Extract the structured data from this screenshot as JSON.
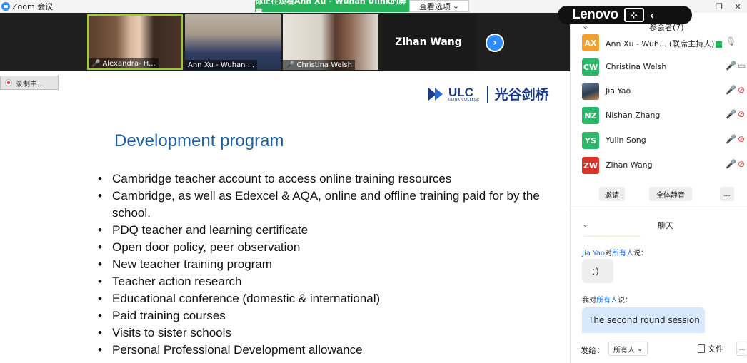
{
  "window": {
    "title": "Zoom 会议"
  },
  "share_banner": {
    "text": "你正在观看Ann Xu - Wuhan Ulink的屏幕",
    "view_options": "查看选项"
  },
  "videos": {
    "tiles": [
      {
        "name": "Alexandra- H..."
      },
      {
        "name": "Ann Xu - Wuhan ..."
      },
      {
        "name": "Christina Welsh"
      }
    ],
    "name_only": "Zihan Wang"
  },
  "recording": {
    "label": "录制中..."
  },
  "lenovo": {
    "word": "Lenovo"
  },
  "slide": {
    "logo_brand": "ULC",
    "logo_sub": "ULINK COLLEGE",
    "logo_cn": "光谷剑桥",
    "title": "Development program",
    "bullets": [
      "Cambridge teacher account to access online training resources",
      "Cambridge, as well as Edexcel & AQA, online and offline training paid for by the school.",
      "PDQ teacher and learning certificate",
      "Open door policy, peer observation",
      "New teacher training program",
      "Teacher action research",
      "Educational conference (domestic & international)",
      "Paid training courses",
      "Visits to sister schools",
      "Personal Professional Development allowance"
    ]
  },
  "participants": {
    "header": "参会者(7)",
    "rows": [
      {
        "initials": "AX",
        "name": "Ann Xu - Wuh... (联席主持人)",
        "color": "#f0a030"
      },
      {
        "initials": "CW",
        "name": "Christina Welsh",
        "color": "#2db76a"
      },
      {
        "initials": "",
        "name": "Jia Yao",
        "color": "#34495e"
      },
      {
        "initials": "NZ",
        "name": "Nishan Zhang",
        "color": "#2db76a"
      },
      {
        "initials": "YS",
        "name": "Yulin Song",
        "color": "#2db76a"
      },
      {
        "initials": "ZW",
        "name": "Zihan Wang",
        "color": "#d9342b"
      }
    ],
    "invite": "邀请",
    "mute_all": "全体静音",
    "more": "..."
  },
  "chat": {
    "header": "聊天",
    "msg1_sender": "Jia Yao",
    "msg1_to_word": "对",
    "msg1_target": "所有人",
    "msg1_suffix": "说：",
    "msg1_text": "：）",
    "msg2_sender": "我",
    "msg2_to_word": "对",
    "msg2_target": "所有人",
    "msg2_suffix": "说：",
    "msg2_text": "The second round session",
    "send_to_label": "发给：",
    "recipient": "所有人",
    "file_label": "文件",
    "more": "..."
  }
}
